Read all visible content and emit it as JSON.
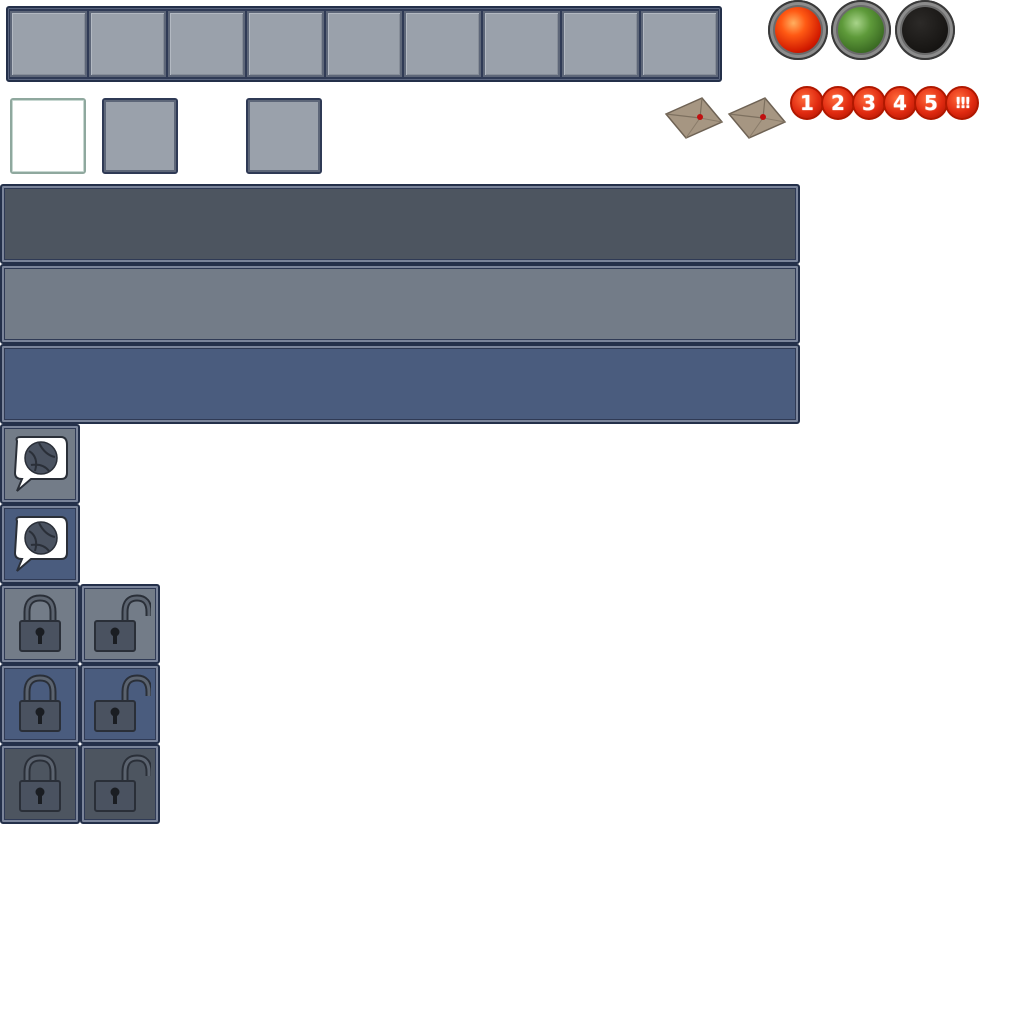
{
  "hotbar": {
    "slot_count": 9,
    "slot_color": "#9aa1ab",
    "frame_color": "#2f3a55"
  },
  "status_orbs": [
    {
      "name": "red-orb",
      "color": "#e02a10"
    },
    {
      "name": "green-orb",
      "color": "#4a7e2e"
    },
    {
      "name": "black-orb",
      "color": "#1a1816"
    }
  ],
  "inventory_slots": [
    {
      "state": "selected",
      "color": "#ffffff"
    },
    {
      "state": "normal",
      "color": "#9aa1ab"
    },
    {
      "state": "normal",
      "color": "#9aa1ab"
    }
  ],
  "envelopes": [
    {
      "icon": "envelope-icon"
    },
    {
      "icon": "envelope-icon"
    }
  ],
  "badges": [
    "1",
    "2",
    "3",
    "4",
    "5",
    "!!!"
  ],
  "panels": [
    {
      "name": "panel-dark",
      "color": "#4d5560"
    },
    {
      "name": "panel-gray",
      "color": "#737c88"
    },
    {
      "name": "panel-blue",
      "color": "#4a5c7e"
    }
  ],
  "chat_tiles": [
    {
      "icon": "chat-bubble-icon",
      "background": "#737c88"
    },
    {
      "icon": "chat-bubble-icon",
      "background": "#4a5c7e"
    }
  ],
  "lock_rows": [
    {
      "background": "#737c88",
      "icons": [
        "lock-closed-icon",
        "lock-open-icon"
      ]
    },
    {
      "background": "#4a5c7e",
      "icons": [
        "lock-closed-icon",
        "lock-open-icon"
      ]
    },
    {
      "background": "#4d5560",
      "icons": [
        "lock-closed-icon",
        "lock-open-icon"
      ]
    }
  ]
}
